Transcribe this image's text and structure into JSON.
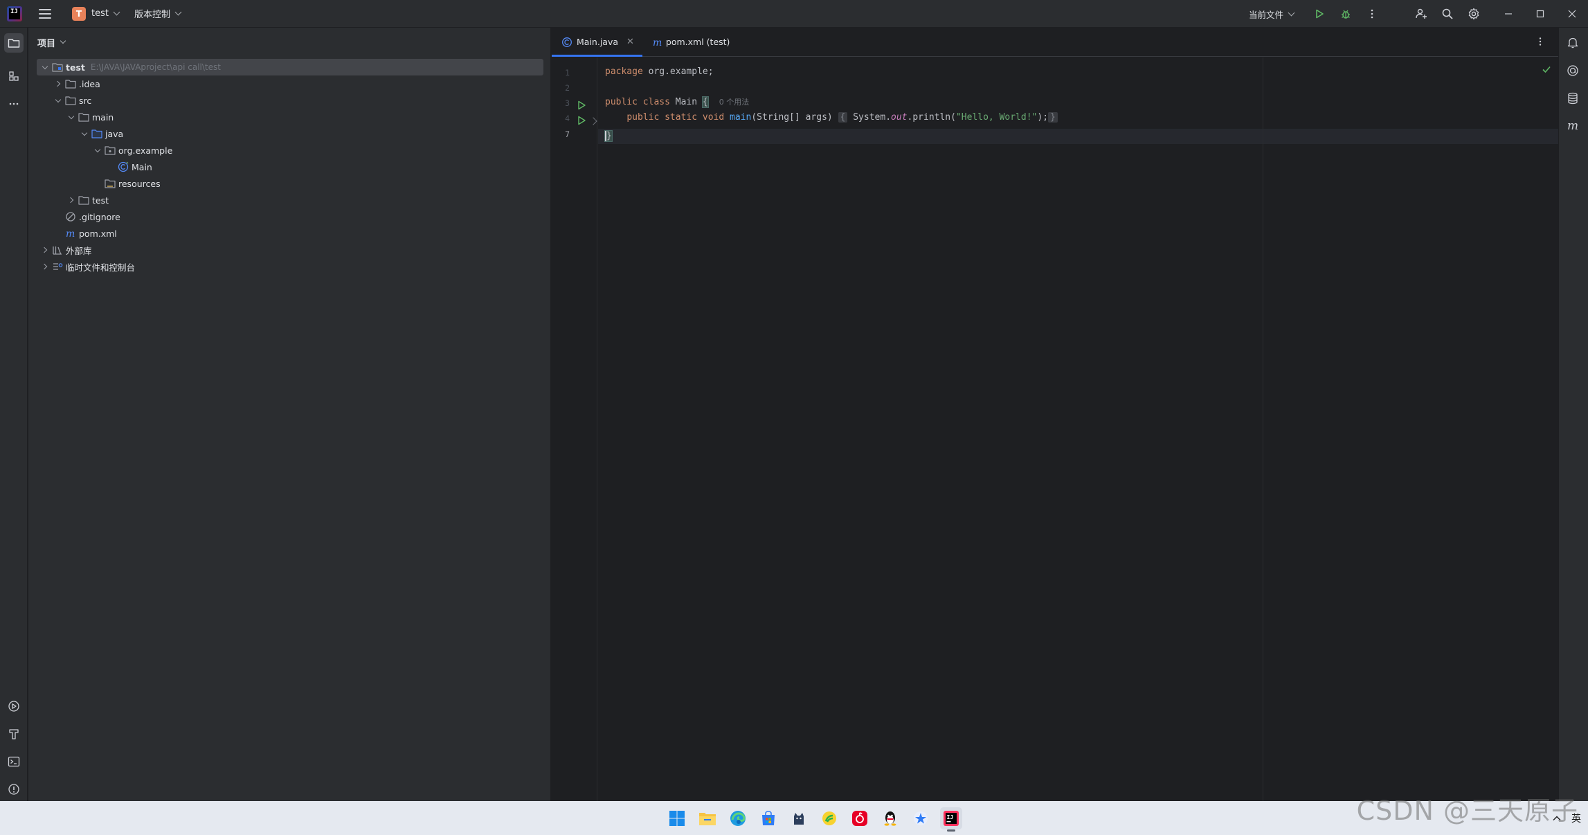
{
  "titlebar": {
    "project_badge": "T",
    "project_name": "test",
    "vcs_label": "版本控制",
    "run_config": "当前文件"
  },
  "project_panel": {
    "title": "项目",
    "tree": [
      {
        "label": "test",
        "hint": "E:\\JAVA\\JAVAproject\\api call\\test",
        "depth": 0,
        "expanded": true,
        "icon": "folder-module-icon"
      },
      {
        "label": ".idea",
        "depth": 1,
        "expanded": false,
        "icon": "folder-icon"
      },
      {
        "label": "src",
        "depth": 1,
        "expanded": true,
        "icon": "folder-icon"
      },
      {
        "label": "main",
        "depth": 2,
        "expanded": true,
        "icon": "folder-icon"
      },
      {
        "label": "java",
        "depth": 3,
        "expanded": true,
        "icon": "source-folder-icon"
      },
      {
        "label": "org.example",
        "depth": 4,
        "expanded": true,
        "icon": "package-icon"
      },
      {
        "label": "Main",
        "depth": 5,
        "icon": "java-class-icon"
      },
      {
        "label": "resources",
        "depth": 3,
        "icon": "resources-folder-icon"
      },
      {
        "label": "test",
        "depth": 2,
        "expanded": false,
        "icon": "folder-icon"
      },
      {
        "label": ".gitignore",
        "depth": 1,
        "icon": "ignore-file-icon"
      },
      {
        "label": "pom.xml",
        "depth": 1,
        "icon": "maven-icon"
      },
      {
        "label": "外部库",
        "depth": 0,
        "expanded": false,
        "icon": "library-icon"
      },
      {
        "label": "临时文件和控制台",
        "depth": 0,
        "expanded": false,
        "icon": "scratches-icon"
      }
    ]
  },
  "editor": {
    "tabs": [
      {
        "label": "Main.java",
        "active": true
      },
      {
        "label": "pom.xml (test)",
        "active": false
      }
    ],
    "line_numbers": [
      "1",
      "2",
      "3",
      "4",
      "7"
    ],
    "code": {
      "l1_kw": "package",
      "l1_rest": " org.example;",
      "l3_kw": "public class",
      "l3_name": " Main ",
      "l3_brace": "{",
      "l3_inlay": "0 个用法",
      "l4_kw": "public static void",
      "l4_fn": "main",
      "l4_args": "(String[] args) ",
      "l4_open": "{",
      "l4_sys": " System.",
      "l4_out": "out",
      "l4_print": ".println(",
      "l4_str": "\"Hello, World!\"",
      "l4_end": ");",
      "l4_close": "}",
      "l7": "}"
    }
  },
  "taskbar": {
    "tray_lang": "英"
  },
  "watermark": "CSDN @三天原子",
  "colors": {
    "accent": "#3574f0",
    "run_green": "#5fb865",
    "keyword": "#cf8e6d",
    "function": "#56a8f5",
    "string": "#6aab73"
  }
}
